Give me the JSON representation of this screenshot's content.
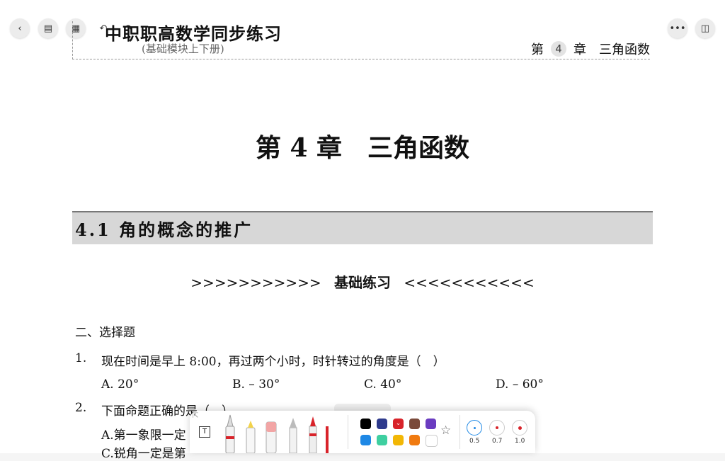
{
  "nav": {
    "back_icon": "chevron-left-icon",
    "sidebar_icon": "sidebar-icon",
    "grid_icon": "grid-icon",
    "undo_icon": "undo-icon",
    "redo_icon": "redo-icon",
    "more_icon": "more-icon",
    "panel_icon": "panel-icon"
  },
  "header": {
    "book_title": "中职职高数学同步练习",
    "subtitle": "(基础模块上下册)",
    "chapter_prefix": "第",
    "chapter_number": "4",
    "chapter_suffix": "章",
    "chapter_name": "三角函数"
  },
  "content": {
    "chapter_heading": "第 4 章　三角函数",
    "section_title": "4.1 角的概念的推广",
    "exercise_title": {
      "left_arrows": ">>>>>>>>>>>",
      "label": "基础练习",
      "right_arrows": "<<<<<<<<<<<"
    },
    "question_type": "二、选择题",
    "q1": {
      "num": "1.",
      "text": "现在时间是早上 8:00，再过两个小时，时针转过的角度是（　）",
      "a": "A. 20°",
      "b": "B. – 30°",
      "c": "C. 40°",
      "d": "D. – 60°"
    },
    "q2": {
      "num": "2.",
      "text": "下面命题正确的是（　）",
      "a": "A.第一象限一定",
      "c": "C.锐角一定是第"
    }
  },
  "toolbar": {
    "colors_row1": [
      "#000000",
      "#2e3a8c",
      "#d8232a",
      "#7a4a3a",
      "#6a3cc0"
    ],
    "colors_row2": [
      "#1e88e5",
      "#3ecfa0",
      "#f2b705",
      "#f07a10",
      "#ffffff"
    ],
    "sizes": [
      "0.5",
      "0.7",
      "1.0"
    ]
  }
}
